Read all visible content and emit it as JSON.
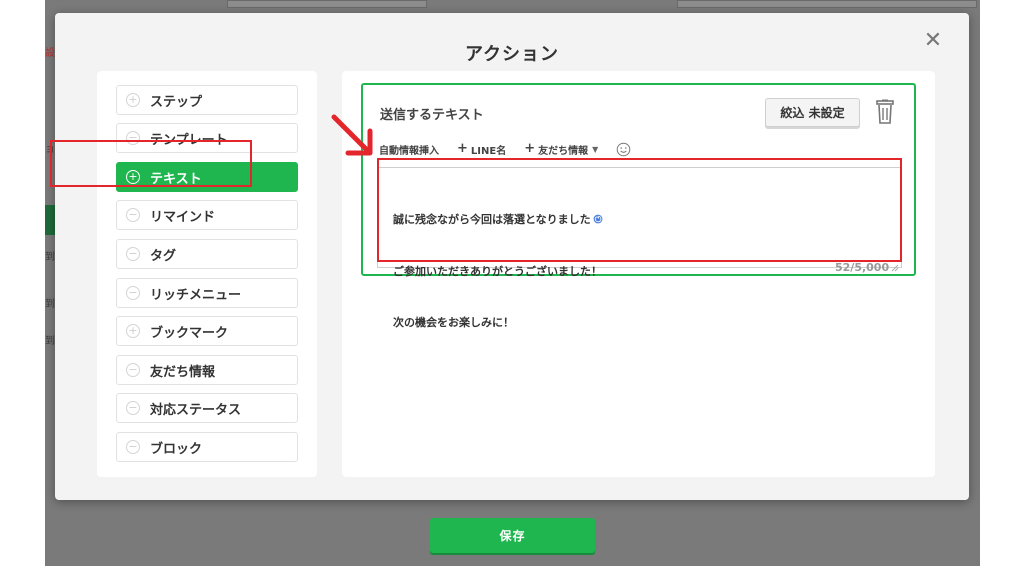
{
  "modal": {
    "title": "アクション",
    "close": "✕"
  },
  "menu": {
    "items": [
      {
        "label": "ステップ",
        "icon": "plus-circle-icon",
        "active": false
      },
      {
        "label": "テンプレート",
        "icon": "minus-circle-icon",
        "active": false
      },
      {
        "label": "テキスト",
        "icon": "plus-circle-icon",
        "active": true
      },
      {
        "label": "リマインド",
        "icon": "minus-circle-icon",
        "active": false
      },
      {
        "label": "タグ",
        "icon": "minus-circle-icon",
        "active": false
      },
      {
        "label": "リッチメニュー",
        "icon": "minus-circle-icon",
        "active": false
      },
      {
        "label": "ブックマーク",
        "icon": "plus-circle-icon",
        "active": false
      },
      {
        "label": "友だち情報",
        "icon": "minus-circle-icon",
        "active": false
      },
      {
        "label": "対応ステータス",
        "icon": "minus-circle-icon",
        "active": false
      },
      {
        "label": "ブロック",
        "icon": "minus-circle-icon",
        "active": false
      }
    ]
  },
  "editor": {
    "title": "送信するテキスト",
    "filter_button": "絞込 未設定",
    "toolbar": {
      "auto_insert_label": "自動情報挿入",
      "line_name": "LINE名",
      "friend_info": "友だち情報"
    },
    "lines": [
      "誠に残念ながら今回は落選となりました",
      "ご参加いただきありがとうございました！",
      "次の機会をお楽しみに！"
    ],
    "char_count": "52/5,000"
  },
  "footer": {
    "save_label": "保存"
  },
  "colors": {
    "accent_green": "#1fb64f",
    "annotation_red": "#e3262c",
    "overlay_gray": "#7a7a7a"
  },
  "background_fragments": {
    "red_char": "設",
    "char_a": "ョ",
    "char_b": "到",
    "char_c": "到",
    "char_d": "到"
  }
}
